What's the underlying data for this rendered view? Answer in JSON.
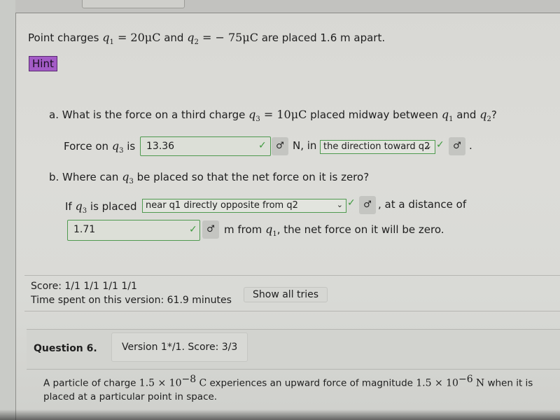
{
  "question": {
    "intro_prefix": "Point charges",
    "q1_sym": "q",
    "q1_sub": "1",
    "q1_value": "= 20μC",
    "and_text": "and",
    "q2_sym": "q",
    "q2_sub": "2",
    "q2_value": "= − 75μC",
    "intro_suffix": "are placed 1.6 m apart.",
    "hint_label": "Hint"
  },
  "part_a": {
    "prompt_prefix": "a. What is the force on a third charge",
    "q3_sym": "q",
    "q3_sub": "3",
    "q3_value": "= 10μC",
    "prompt_mid": "placed midway between",
    "q1_sym": "q",
    "q1_sub": "1",
    "prompt_and": "and",
    "q2_sym": "q",
    "q2_sub": "2",
    "prompt_end": "?",
    "force_label_prefix": "Force on",
    "force_q_sym": "q",
    "force_q_sub": "3",
    "force_label_suffix": "is",
    "force_value": "13.36",
    "unit_text": "N, in",
    "direction_selected": "the direction toward q2",
    "period": ".",
    "check_icon": "✓",
    "key_icon": "♂"
  },
  "part_b": {
    "prompt_prefix": "b. Where can",
    "q3_sym": "q",
    "q3_sub": "3",
    "prompt_suffix": "be placed so that the net force on it is zero?",
    "placed_prefix": "If",
    "placed_q_sym": "q",
    "placed_q_sub": "3",
    "placed_mid": "is placed",
    "position_selected": "near q1 directly opposite from q2",
    "distance_text": ", at a distance of",
    "distance_value": "1.71",
    "from_text": "m from",
    "from_q_sym": "q",
    "from_q_sub": "1",
    "zero_text": ", the net force on it will be zero.",
    "check_icon": "✓",
    "key_icon": "♂"
  },
  "score": {
    "score_line": "Score: 1/1 1/1 1/1 1/1",
    "time_line": "Time spent on this version: 61.9 minutes",
    "show_tries_label": "Show all tries"
  },
  "question6": {
    "title": "Question 6.",
    "version_text": "Version 1*/1. Score: 3/3",
    "text_1": "A particle of charge",
    "charge_mantissa": "1.5 × 10",
    "charge_exp": "−8",
    "charge_unit": "C",
    "text_2": "experiences an upward force of magnitude",
    "force_mantissa": "1.5 × 10",
    "force_exp": "−6",
    "force_unit": "N",
    "text_3": "when it is placed at a particular point in space."
  },
  "colors": {
    "hint_purple": "#a35bc6",
    "correct_green": "#3e9a3e"
  }
}
